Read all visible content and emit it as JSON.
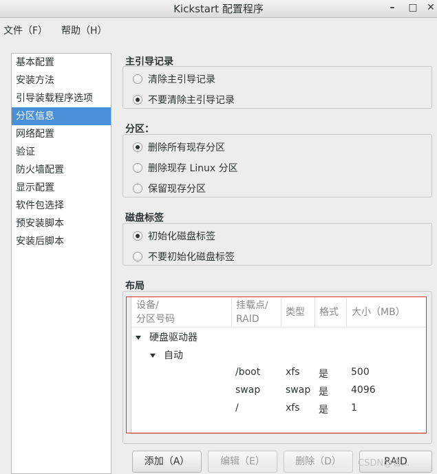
{
  "window": {
    "title": "Kickstart 配置程序",
    "minimize_glyph": "–",
    "maximize_glyph": "□",
    "close_glyph": "✕"
  },
  "menubar": {
    "file": "文件（F）",
    "help": "帮助（H）"
  },
  "sidebar": {
    "items": [
      {
        "label": "基本配置"
      },
      {
        "label": "安装方法"
      },
      {
        "label": "引导装载程序选项"
      },
      {
        "label": "分区信息"
      },
      {
        "label": "网络配置"
      },
      {
        "label": "验证"
      },
      {
        "label": "防火墙配置"
      },
      {
        "label": "显示配置"
      },
      {
        "label": "软件包选择"
      },
      {
        "label": "预安装脚本"
      },
      {
        "label": "安装后脚本"
      }
    ],
    "selected": "分区信息"
  },
  "mbr": {
    "title": "主引导记录",
    "options": [
      {
        "label": "清除主引导记录",
        "checked": false
      },
      {
        "label": "不要清除主引导记录",
        "checked": true
      }
    ]
  },
  "partitions": {
    "title": "分区：",
    "options": [
      {
        "label": "删除所有现存分区",
        "checked": true
      },
      {
        "label": "删除现存 Linux 分区",
        "checked": false
      },
      {
        "label": "保留现存分区",
        "checked": false
      }
    ]
  },
  "disklabel": {
    "title": "磁盘标签",
    "options": [
      {
        "label": "初始化磁盘标签",
        "checked": true
      },
      {
        "label": "不要初始化磁盘标签",
        "checked": false
      }
    ]
  },
  "layout": {
    "title": "布局",
    "columns": {
      "device_line1": "设备/",
      "device_line2": "分区号码",
      "mount_line1": "挂载点/",
      "mount_line2": "RAID",
      "type": "类型",
      "format": "格式",
      "size": "大小（MB）"
    },
    "tree": {
      "root_label": "硬盘驱动器",
      "child_label": "自动",
      "rows": [
        {
          "mount": "/boot",
          "type": "xfs",
          "format": "是",
          "size": "500"
        },
        {
          "mount": "swap",
          "type": "swap",
          "format": "是",
          "size": "4096"
        },
        {
          "mount": "/",
          "type": "xfs",
          "format": "是",
          "size": "1"
        }
      ]
    }
  },
  "buttons": {
    "add": "添加（A）",
    "edit": "编辑（E）",
    "delete": "删除（D）",
    "raid": "RAID"
  },
  "watermark": "CSDN@言..."
}
